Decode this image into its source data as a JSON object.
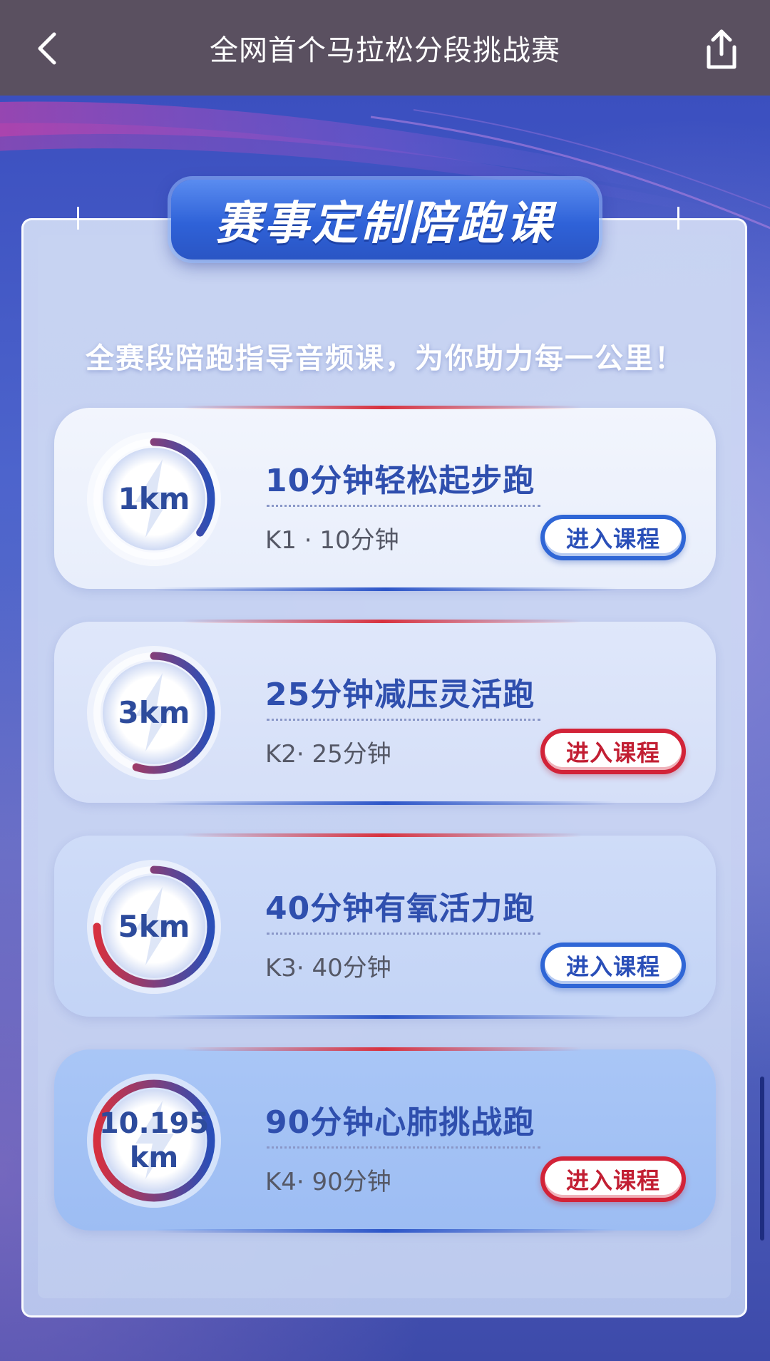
{
  "nav": {
    "title": "全网首个马拉松分段挑战赛",
    "back_icon": "chevron-left-icon",
    "share_icon": "share-icon"
  },
  "section": {
    "badge": "赛事定制陪跑课",
    "subtitle": "全赛段陪跑指导音频课，为你助力每一公里！"
  },
  "courses": [
    {
      "distance": "1km",
      "distance_line2": "",
      "title": "10分钟轻松起步跑",
      "meta": "K1 · 10分钟",
      "button": "进入课程",
      "button_color": "blue",
      "ring_progress": 0.35
    },
    {
      "distance": "3km",
      "distance_line2": "",
      "title": "25分钟减压灵活跑",
      "meta": "K2· 25分钟",
      "button": "进入课程",
      "button_color": "red",
      "ring_progress": 0.55
    },
    {
      "distance": "5km",
      "distance_line2": "",
      "title": "40分钟有氧活力跑",
      "meta": "K3· 40分钟",
      "button": "进入课程",
      "button_color": "blue",
      "ring_progress": 0.75
    },
    {
      "distance": "10.195",
      "distance_line2": "km",
      "title": "90分钟心肺挑战跑",
      "meta": "K4· 90分钟",
      "button": "进入课程",
      "button_color": "red",
      "ring_progress": 1.0
    }
  ],
  "colors": {
    "nav_bg": "#5a5060",
    "brand_blue": "#2f66d6",
    "brand_red": "#d22338",
    "title_text": "#2f4fae"
  }
}
